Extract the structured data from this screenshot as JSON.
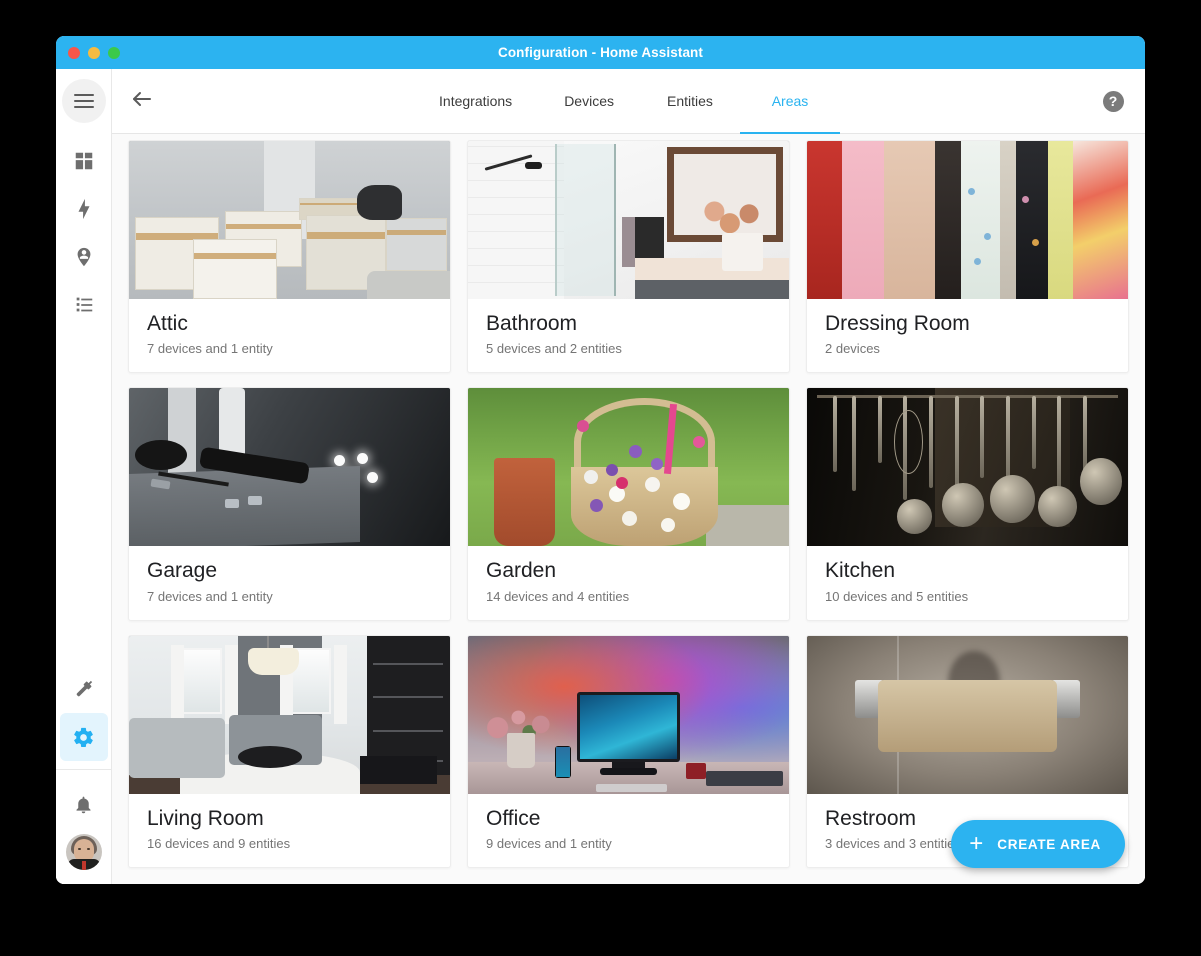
{
  "window": {
    "title": "Configuration - Home Assistant",
    "traffic_lights": [
      "close",
      "minimize",
      "zoom"
    ],
    "accent_color": "#2cb3f0",
    "titlebar_color": "#2cb3f0"
  },
  "sidebar": {
    "menu_button": "hamburger-menu",
    "items": [
      {
        "name": "overview",
        "icon": "view-dashboard-icon",
        "active": false
      },
      {
        "name": "energy",
        "icon": "lightning-bolt-icon",
        "active": false
      },
      {
        "name": "map",
        "icon": "map-marker-account-icon",
        "active": false
      },
      {
        "name": "logbook",
        "icon": "format-list-icon",
        "active": false
      },
      {
        "name": "developer-tools",
        "icon": "hammer-icon",
        "active": false
      },
      {
        "name": "configuration",
        "icon": "cog-icon",
        "active": true
      }
    ],
    "bottom": [
      {
        "name": "notifications",
        "icon": "bell-icon"
      },
      {
        "name": "user-profile",
        "icon": "avatar"
      }
    ]
  },
  "topbar": {
    "back_icon": "arrow-left-icon",
    "help_icon": "help-circle-icon",
    "help_glyph": "?",
    "tabs": [
      {
        "label": "Integrations",
        "active": false
      },
      {
        "label": "Devices",
        "active": false
      },
      {
        "label": "Entities",
        "active": false
      },
      {
        "label": "Areas",
        "active": true
      }
    ]
  },
  "areas": [
    {
      "name": "Attic",
      "summary": "7 devices and 1 entity",
      "scene": "s-attic",
      "image_alt": "cardboard moving boxes in an attic"
    },
    {
      "name": "Bathroom",
      "summary": "5 devices and 2 entities",
      "scene": "s-bath",
      "image_alt": "white modern bathroom with glass shower"
    },
    {
      "name": "Dressing Room",
      "summary": "2 devices",
      "scene": "s-dress",
      "image_alt": "colorful clothes hanging on a rack"
    },
    {
      "name": "Garage",
      "summary": "7 devices and 1 entity",
      "scene": "s-garage",
      "image_alt": "black screwdriver and screws on a workbench"
    },
    {
      "name": "Garden",
      "summary": "14 devices and 4 entities",
      "scene": "s-garden",
      "image_alt": "flower basket on a sunny lawn"
    },
    {
      "name": "Kitchen",
      "summary": "10 devices and 5 entities",
      "scene": "s-kitchen",
      "image_alt": "hanging metal kitchen utensils in the dark"
    },
    {
      "name": "Living Room",
      "summary": "16 devices and 9 entities",
      "scene": "s-living",
      "image_alt": "grey and white modern living room"
    },
    {
      "name": "Office",
      "summary": "9 devices and 1 entity",
      "scene": "s-office",
      "image_alt": "desk with monitor and RGB ambient lighting"
    },
    {
      "name": "Restroom",
      "summary": "3 devices and 3 entities",
      "scene": "s-rest",
      "image_alt": "empty toilet paper roll on a holder"
    }
  ],
  "fab": {
    "label": "CREATE AREA",
    "icon": "plus-icon",
    "glyph": "+",
    "color": "#2cb3f0"
  }
}
